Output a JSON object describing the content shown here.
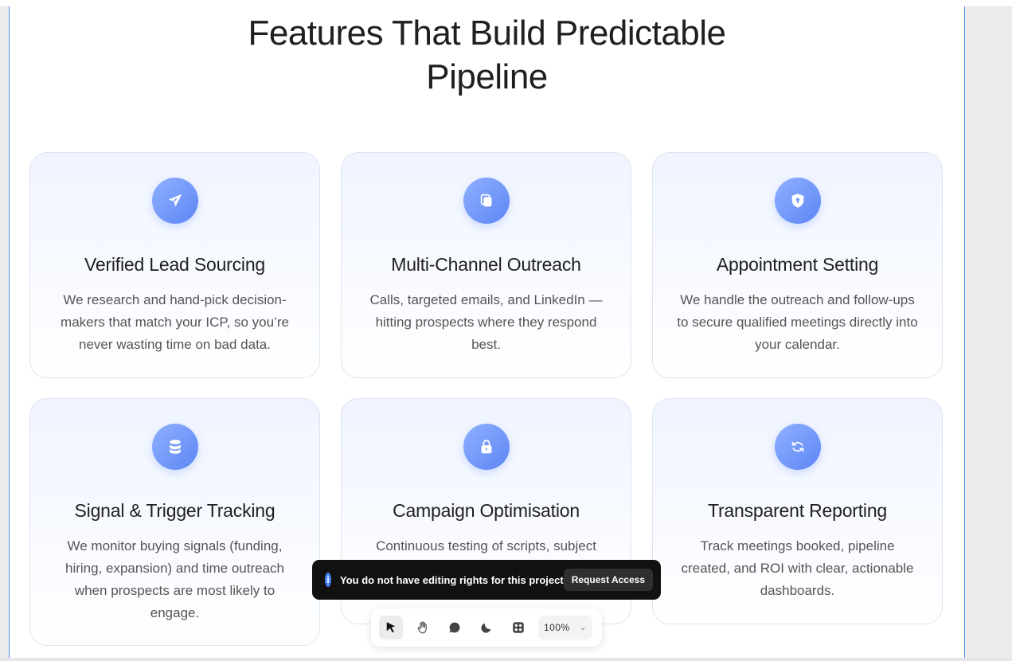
{
  "heading": {
    "line1": "Features That Build Predictable",
    "line2": "Pipeline"
  },
  "cards": [
    {
      "title": "Verified Lead Sourcing",
      "desc": "We research and hand-pick decision-makers that match your ICP, so you’re never wasting time on bad data.",
      "icon": "paper-plane-icon"
    },
    {
      "title": "Multi-Channel Outreach",
      "desc": "Calls, targeted emails, and LinkedIn — hitting prospects where they respond best.",
      "icon": "copy-icon"
    },
    {
      "title": "Appointment Setting",
      "desc": "We handle the outreach and follow-ups to secure qualified meetings directly into your calendar.",
      "icon": "shield-icon"
    },
    {
      "title": "Signal & Trigger Tracking",
      "desc": "We monitor buying signals (funding, hiring, expansion) and time outreach when prospects are most likely to engage.",
      "icon": "database-icon"
    },
    {
      "title": "Campaign Optimisation",
      "desc": "Continuous testing of scripts, subject",
      "icon": "lock-icon"
    },
    {
      "title": "Transparent Reporting",
      "desc": "Track meetings booked, pipeline created, and ROI with clear, actionable dashboards.",
      "icon": "refresh-icon"
    }
  ],
  "toast": {
    "message": "You do not have editing rights for this project",
    "button": "Request Access",
    "info": "i"
  },
  "toolbar": {
    "zoom": "100%"
  },
  "colors": {
    "accent": "#5d86f5",
    "toast_bg": "#111111",
    "frame_border": "#4a8fe6"
  }
}
